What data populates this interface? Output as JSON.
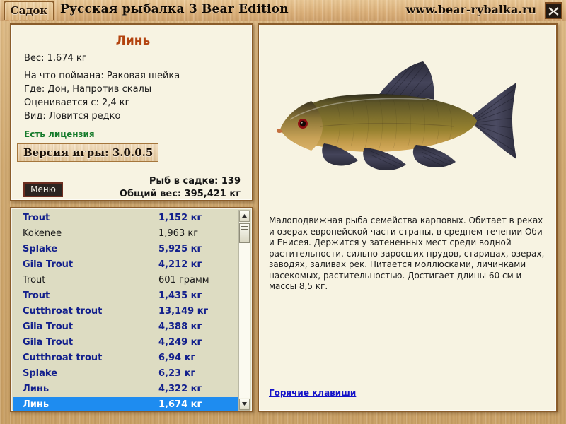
{
  "titlebar": {
    "tab_label": "Садок",
    "app_title": "Русская рыбалка 3 Bear Edition",
    "site_url": "www.bear-rybalka.ru",
    "close_icon": "close-icon"
  },
  "fish_info": {
    "name": "Линь",
    "weight_line": "Вес: 1,674 кг",
    "bait_line": "На что поймана: Раковая шейка",
    "place_line": "Где: Дон, Напротив скалы",
    "valued_line": "Оценивается с: 2,4 кг",
    "kind_line": "Вид: Ловится редко",
    "license_status": "Есть лицензия",
    "version_banner": "Версия игры: 3.0.0.5",
    "menu_button": "Меню",
    "fish_count_line": "Рыб в садке: 139",
    "total_weight_line": "Общий вес: 395,421 кг"
  },
  "catch_list": {
    "rows": [
      {
        "fish": "Trout",
        "weight": "1,152 кг",
        "style": "trophy",
        "selected": false
      },
      {
        "fish": "Kokenee",
        "weight": "1,963 кг",
        "style": "normal",
        "selected": false
      },
      {
        "fish": "Splake",
        "weight": "5,925 кг",
        "style": "trophy",
        "selected": false
      },
      {
        "fish": "Gila Trout",
        "weight": "4,212 кг",
        "style": "trophy",
        "selected": false
      },
      {
        "fish": "Trout",
        "weight": "601 грамм",
        "style": "normal",
        "selected": false
      },
      {
        "fish": "Trout",
        "weight": "1,435 кг",
        "style": "trophy",
        "selected": false
      },
      {
        "fish": "Cutthroat trout",
        "weight": "13,149 кг",
        "style": "trophy",
        "selected": false
      },
      {
        "fish": "Gila Trout",
        "weight": "4,388 кг",
        "style": "trophy",
        "selected": false
      },
      {
        "fish": "Gila Trout",
        "weight": "4,249 кг",
        "style": "trophy",
        "selected": false
      },
      {
        "fish": "Cutthroat trout",
        "weight": "6,94 кг",
        "style": "trophy",
        "selected": false
      },
      {
        "fish": "Splake",
        "weight": "6,23 кг",
        "style": "trophy",
        "selected": false
      },
      {
        "fish": "Линь",
        "weight": "4,322 кг",
        "style": "trophy",
        "selected": false
      },
      {
        "fish": "Линь",
        "weight": "1,674 кг",
        "style": "trophy",
        "selected": true
      }
    ],
    "scrollbar": {
      "up_icon": "scroll-up-arrow-icon",
      "down_icon": "scroll-down-arrow-icon"
    }
  },
  "fish_detail": {
    "image_name": "tench-fish-image",
    "description": "Малоподвижная рыба семейства карповых. Обитает в реках и озерах европейской части страны, в среднем течении Оби и Енисея. Держится  у затененных мест среди водной растительности, сильно заросших прудов, старицах, озерах, заводях, заливах рек. Питается моллюсками, личинками насекомых, растительностью. Достигает длины 60 см и массы 8,5 кг.",
    "hotkeys_link": "Горячие клавиши"
  },
  "colors": {
    "wood": "#c99f63",
    "panel_cream": "#f7f3e2",
    "list_beige": "#dddcc2",
    "trophy_blue": "#13208c",
    "selection_blue": "#1e8cf0",
    "fish_name_orange": "#b3430f",
    "license_green": "#157a2b",
    "link_blue": "#1412c8"
  }
}
